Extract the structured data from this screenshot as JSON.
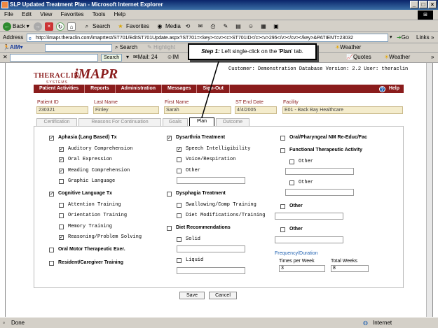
{
  "window": {
    "title": "SLP Updated Treatment Plan - Microsoft Internet Explorer"
  },
  "menu": [
    "File",
    "Edit",
    "View",
    "Favorites",
    "Tools",
    "Help"
  ],
  "toolbar": {
    "back": "Back",
    "search": "Search",
    "favorites": "Favorites",
    "media": "Media",
    "go": "Go",
    "links": "Links"
  },
  "address": {
    "label": "Address",
    "url": "http://imapr.theraclin.com/imaprtest/ST701/EditST701Update.aspx?ST701=<key><cv><c>ST701ID</c><v>295</v></cv></key>&PATIENT=23032"
  },
  "aimbar": {
    "aim": "AIM",
    "search": "Search",
    "highlight": "Highlight",
    "weather": "Weather"
  },
  "aimbar2": {
    "search": "Search",
    "mail": "Mail: 24",
    "im": "IM",
    "quotes": "Quotes",
    "weather": "Weather"
  },
  "callout": {
    "step": "Step 1:",
    "text": " Left single-click on the 'Plan' tab.",
    "plan": "Plan"
  },
  "app": {
    "logo_brand": "THERACLIN",
    "logo_product": "iMAPR",
    "logo_sub": "SYSTEMS",
    "customer_line": "Customer: Demonstration Database Version: 2.2 User: theraclin",
    "nav": [
      "Patient Activities",
      "Reports",
      "Administration",
      "Messages",
      "Sign-Out"
    ],
    "help": "Help",
    "patient": {
      "id_label": "Patient ID",
      "id": "230321",
      "last_label": "Last Name",
      "last": "Finley",
      "first_label": "First Name",
      "first": "Sarah",
      "end_label": "ST End Date",
      "end": "4/4/2005",
      "facility_label": "Facility",
      "facility": "E01 - Back Bay Healthcare"
    },
    "tabs": [
      "Certification",
      "Reasons For Continuation",
      "Goals",
      "Plan",
      "Outcome"
    ],
    "col1": {
      "aphasia": "Aphasia (Lang Based) Tx",
      "aphasia_items": [
        "Auditory Comprehension",
        "Oral Expression",
        "Reading Comprehension",
        "Graphic Language"
      ],
      "cognitive": "Cognitive Language Tx",
      "cognitive_items": [
        "Attention Training",
        "Orientation Training",
        "Memory Training",
        "Reasoning/Problem Solving"
      ],
      "oral_motor": "Oral Motor Therapeutic Exer.",
      "resident": "Resident/Caregiver Training"
    },
    "col2": {
      "dysarthria": "Dysarthria Treatment",
      "dysarthria_items": [
        "Speech Intelligibility",
        "Voice/Respiration",
        "Other"
      ],
      "dysphagia": "Dysphagia Treatment",
      "dysphagia_items": [
        "Swallowing/Comp Training",
        "Diet Modifications/Training"
      ],
      "diet": "Diet Recommendations",
      "diet_items": [
        "Solid",
        "Liquid"
      ]
    },
    "col3": {
      "oral_pharyngeal": "Oral/Pharyngeal NM Re-Educ/Fac",
      "functional": "Functional Therapeutic Activity",
      "other1": "Other",
      "other2": "Other",
      "other3": "Other",
      "other4": "Other",
      "freq_header": "Frequency/Duration",
      "times_label": "Times per Week",
      "times_value": "3",
      "weeks_label": "Total Weeks",
      "weeks_value": "8"
    },
    "buttons": {
      "save": "Save",
      "cancel": "Cancel"
    }
  },
  "status": {
    "left": "Done",
    "zone": "Internet"
  },
  "colors": {
    "brand": "#8a1c1c",
    "freq": "#1d5fb0",
    "chrome": "#d4d0c8"
  }
}
